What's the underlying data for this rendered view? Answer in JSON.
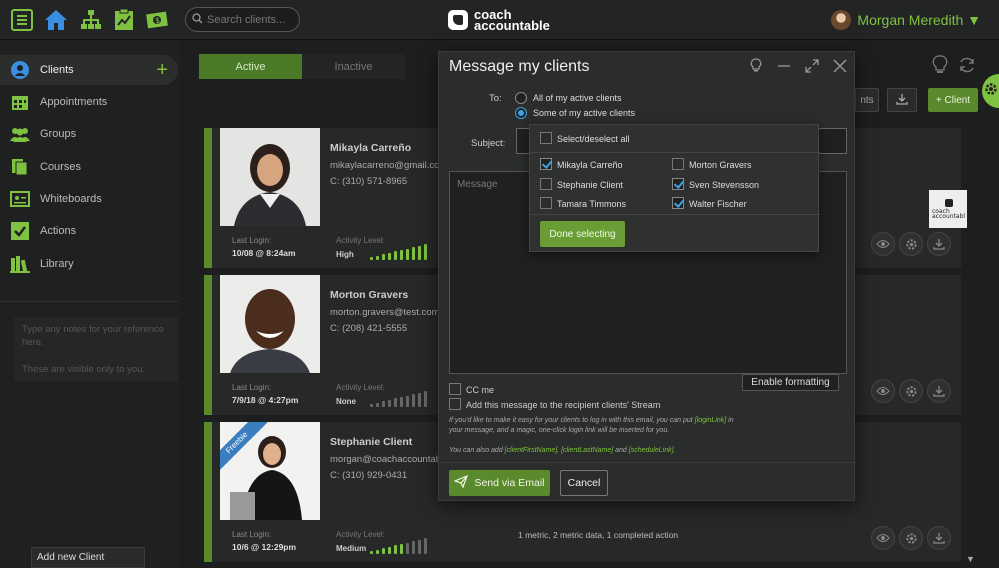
{
  "topbar": {
    "search_placeholder": "Search clients...",
    "logo_line1": "coach",
    "logo_line2": "accountable",
    "user_name": "Morgan Meredith ▼"
  },
  "sidebar": {
    "items": [
      {
        "label": "Clients",
        "icon": "user-icon"
      },
      {
        "label": "Appointments",
        "icon": "calendar-icon"
      },
      {
        "label": "Groups",
        "icon": "group-icon"
      },
      {
        "label": "Courses",
        "icon": "courses-icon"
      },
      {
        "label": "Whiteboards",
        "icon": "whiteboard-icon"
      },
      {
        "label": "Actions",
        "icon": "check-icon"
      },
      {
        "label": "Library",
        "icon": "library-icon"
      }
    ],
    "notes_line1": "Type any notes for your reference here.",
    "notes_line2": "These are visible only to you.",
    "add_client": "Add new Client"
  },
  "tabs": {
    "active": "Active",
    "inactive": "Inactive"
  },
  "toolbar": {
    "partial_label": "nts",
    "add_client": "+ Client"
  },
  "clients": [
    {
      "name": "Mikayla Carreño",
      "email": "mikaylacarreno@gmail.com",
      "phone": "C: (310) 571-8965",
      "last_login_label": "Last Login:",
      "last_login": "10/08 @ 8:24am",
      "activity_label": "Activity Level:",
      "activity": "High",
      "activity_level": 10
    },
    {
      "name": "Morton Gravers",
      "email": "morton.gravers@test.com",
      "phone": "C: (208) 421-5555",
      "last_login_label": "Last Login:",
      "last_login": "7/9/18 @ 4:27pm",
      "activity_label": "Activity Level:",
      "activity": "None",
      "activity_level": 0
    },
    {
      "name": "Stephanie Client",
      "email": "morgan@coachaccountable.c",
      "phone": "C: (310) 929-0431",
      "last_login_label": "Last Login:",
      "last_login": "10/6 @ 12:29pm",
      "activity_label": "Activity Level:",
      "activity": "Medium",
      "activity_level": 6,
      "ribbon": "Freebie",
      "metrics": "1 metric, 2 metric data, 1 completed action"
    }
  ],
  "modal": {
    "title": "Message my clients",
    "to_label": "To:",
    "opt_all": "All of my active clients",
    "opt_some": "Some of my active clients",
    "subject_label": "Subject:",
    "message_placeholder": "Message",
    "enable_formatting": "Enable formatting",
    "cc_me": "CC me",
    "add_stream": "Add this message to the recipient clients' Stream",
    "help1_a": "If you'd like to make it easy for your clients to log in with this email, you can put ",
    "help1_link": "[loginLink]",
    "help1_b": " in your message, and a magic, one-click login link will be inserted for you.",
    "help2_a": "You can also add ",
    "help2_t1": "[clientFirstName]",
    "help2_c1": ", ",
    "help2_t2": "[clientLastName]",
    "help2_c2": " and ",
    "help2_t3": "[scheduleLink]",
    "help2_end": ".",
    "send": "Send via Email",
    "cancel": "Cancel"
  },
  "picker": {
    "select_all": "Select/deselect all",
    "clients": [
      {
        "name": "Mikayla Carreño",
        "checked": true
      },
      {
        "name": "Morton Gravers",
        "checked": false
      },
      {
        "name": "Stephanie Client",
        "checked": false
      },
      {
        "name": "Sven Stevensson",
        "checked": true
      },
      {
        "name": "Tamara Timmons",
        "checked": false
      },
      {
        "name": "Walter Fischer",
        "checked": true
      }
    ],
    "done": "Done selecting"
  },
  "colors": {
    "accent": "#7fc241",
    "accent_dark": "#5a8a2c",
    "radio": "#3ea2e6"
  }
}
